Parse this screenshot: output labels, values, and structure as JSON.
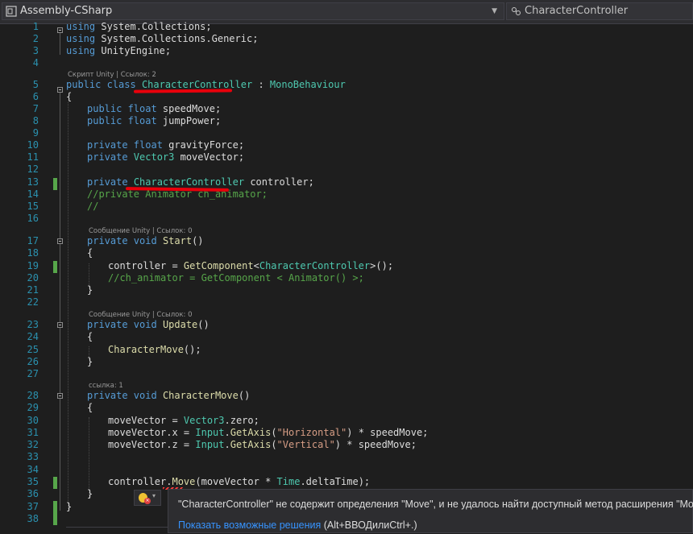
{
  "nav": {
    "project": "Assembly-CSharp",
    "member": "CharacterController"
  },
  "lens": {
    "l5": "Скрипт Unity | Ссылок: 2",
    "l17": "Сообщение Unity | Ссылок: 0",
    "l23": "Сообщение Unity | Ссылок: 0",
    "l28": "ссылка: 1"
  },
  "code": {
    "l1_kw": "using",
    "l1_rest": " System.Collections;",
    "l2_kw": "using",
    "l2_rest": " System.Collections.Generic;",
    "l3_kw": "using",
    "l3_rest": " UnityEngine;",
    "l5_kw": "public class",
    "l5_type": "CharacterController",
    "l5_colon": " : ",
    "l5_base": "MonoBehaviour",
    "l6": "{",
    "l7_kw": "public float",
    "l7_rest": " speedMove;",
    "l8_kw": "public float",
    "l8_rest": " jumpPower;",
    "l10_kw": "private float",
    "l10_rest": " gravityForce;",
    "l11_kw": "private",
    "l11_type": " Vector3",
    "l11_rest": " moveVector;",
    "l13_kw": "private",
    "l13_type": "CharacterController",
    "l13_rest": " controller;",
    "l14": "//private Animator ch_animator;",
    "l15": "//",
    "l17_kw": "private void",
    "l17_m": "Start",
    "l17_rest": "()",
    "l18": "{",
    "l19_a": "controller = ",
    "l19_m": "GetComponent",
    "l19_b": "<",
    "l19_t": "CharacterController",
    "l19_c": ">();",
    "l20": "//ch_animator = GetComponent < Animator() >;",
    "l21": "}",
    "l23_kw": "private void",
    "l23_m": "Update",
    "l23_rest": "()",
    "l24": "{",
    "l25_m": "CharacterMove",
    "l25_rest": "();",
    "l26": "}",
    "l28_kw": "private void",
    "l28_m": "CharacterMove",
    "l28_rest": "()",
    "l29": "{",
    "l30_a": "moveVector = ",
    "l30_t": "Vector3",
    "l30_b": ".zero;",
    "l31_a": "moveVector.x = ",
    "l31_t": "Input",
    "l31_b": ".",
    "l31_m": "GetAxis",
    "l31_c": "(",
    "l31_s": "\"Horizontal\"",
    "l31_d": ") * speedMove;",
    "l32_a": "moveVector.z = ",
    "l32_t": "Input",
    "l32_b": ".",
    "l32_m": "GetAxis",
    "l32_c": "(",
    "l32_s": "\"Vertical\"",
    "l32_d": ") * speedMove;",
    "l35_a": "controller.",
    "l35_m": "Move",
    "l35_b": "(moveVector * ",
    "l35_t": "Time",
    "l35_c": ".deltaTime);",
    "l36": "}",
    "l37": "}"
  },
  "line_numbers": [
    "1",
    "2",
    "3",
    "4",
    "5",
    "6",
    "7",
    "8",
    "9",
    "10",
    "11",
    "12",
    "13",
    "14",
    "15",
    "16",
    "17",
    "18",
    "19",
    "20",
    "21",
    "22",
    "23",
    "24",
    "25",
    "26",
    "27",
    "28",
    "29",
    "30",
    "31",
    "32",
    "33",
    "34",
    "35",
    "36",
    "37",
    "38"
  ],
  "tooltip": {
    "message": "\"CharacterController\" не содержит определения \"Move\", и не удалось найти доступный метод расширения \"Move\",",
    "fix_link": "Показать возможные решения",
    "fix_shortcut": " (Alt+ВВОДилиCtrl+.)"
  },
  "colors": {
    "background": "#1e1e1e",
    "keyword": "#569cd6",
    "type": "#4ec9b0",
    "method": "#dcdcaa",
    "string": "#d69d85",
    "comment": "#57a64a",
    "line_number": "#2b91af",
    "annotation_underline": "#e8000b",
    "link": "#3794ff"
  }
}
